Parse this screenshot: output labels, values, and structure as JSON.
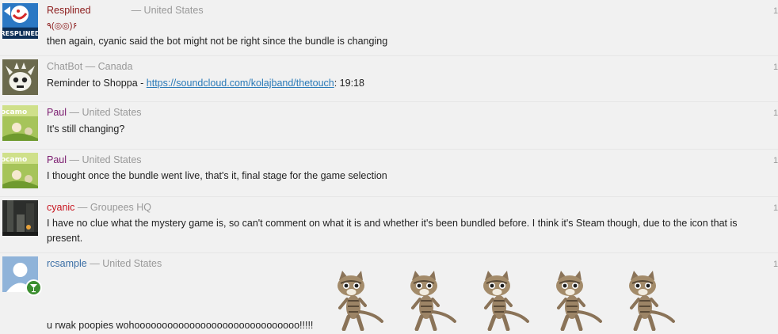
{
  "colors": {
    "background": "#f1f1f1",
    "name_resplined": "#8b1a1a",
    "name_chatbot": "#999999",
    "name_paul": "#7a1a6e",
    "name_cyanic": "#c8151f",
    "name_rcsample": "#3a6ea5",
    "link": "#2a7ab8"
  },
  "separator": "—",
  "messages": [
    {
      "username": "Resplined",
      "location": "United States",
      "sub_text": "٩(◎◎)۶",
      "text": "then again, cyanic said the bot might not be right since the bundle is changing",
      "avatar_icon": "resplined-logo-avatar",
      "avatar_caption": "RESPLINED",
      "timestamp": "1"
    },
    {
      "username": "ChatBot",
      "location": "Canada",
      "text_before": "Reminder to Shoppa - ",
      "link": "https://soundcloud.com/kolajband/thetouch",
      "text_after": ": 19:18",
      "avatar_icon": "robot-creature-avatar",
      "timestamp": "1"
    },
    {
      "username": "Paul",
      "location": "United States",
      "text": "It's still changing?",
      "avatar_icon": "green-cartoon-avatar",
      "timestamp": "1"
    },
    {
      "username": "Paul",
      "location": "United States",
      "text": "I thought once the bundle went live, that's it, final stage for the game selection",
      "avatar_icon": "green-cartoon-avatar",
      "timestamp": "1"
    },
    {
      "username": "cyanic",
      "location": "Groupees HQ",
      "text": "I have no clue what the mystery game is, so can't comment on what it is and whether it's been bundled before. I think it's Steam though, due to the icon that is present.",
      "avatar_icon": "dark-scene-avatar",
      "timestamp": "1"
    },
    {
      "username": "rcsample",
      "location": "United States",
      "text": "u rwak poopies wohoooooooooooooooooooooooooooooo!!!!!",
      "avatar_icon": "default-user-avatar",
      "badge_icon": "cocktail-glass-icon",
      "timestamp": "1",
      "emote_icon": "dancing-kitten-icon",
      "emote_count": 5
    }
  ]
}
